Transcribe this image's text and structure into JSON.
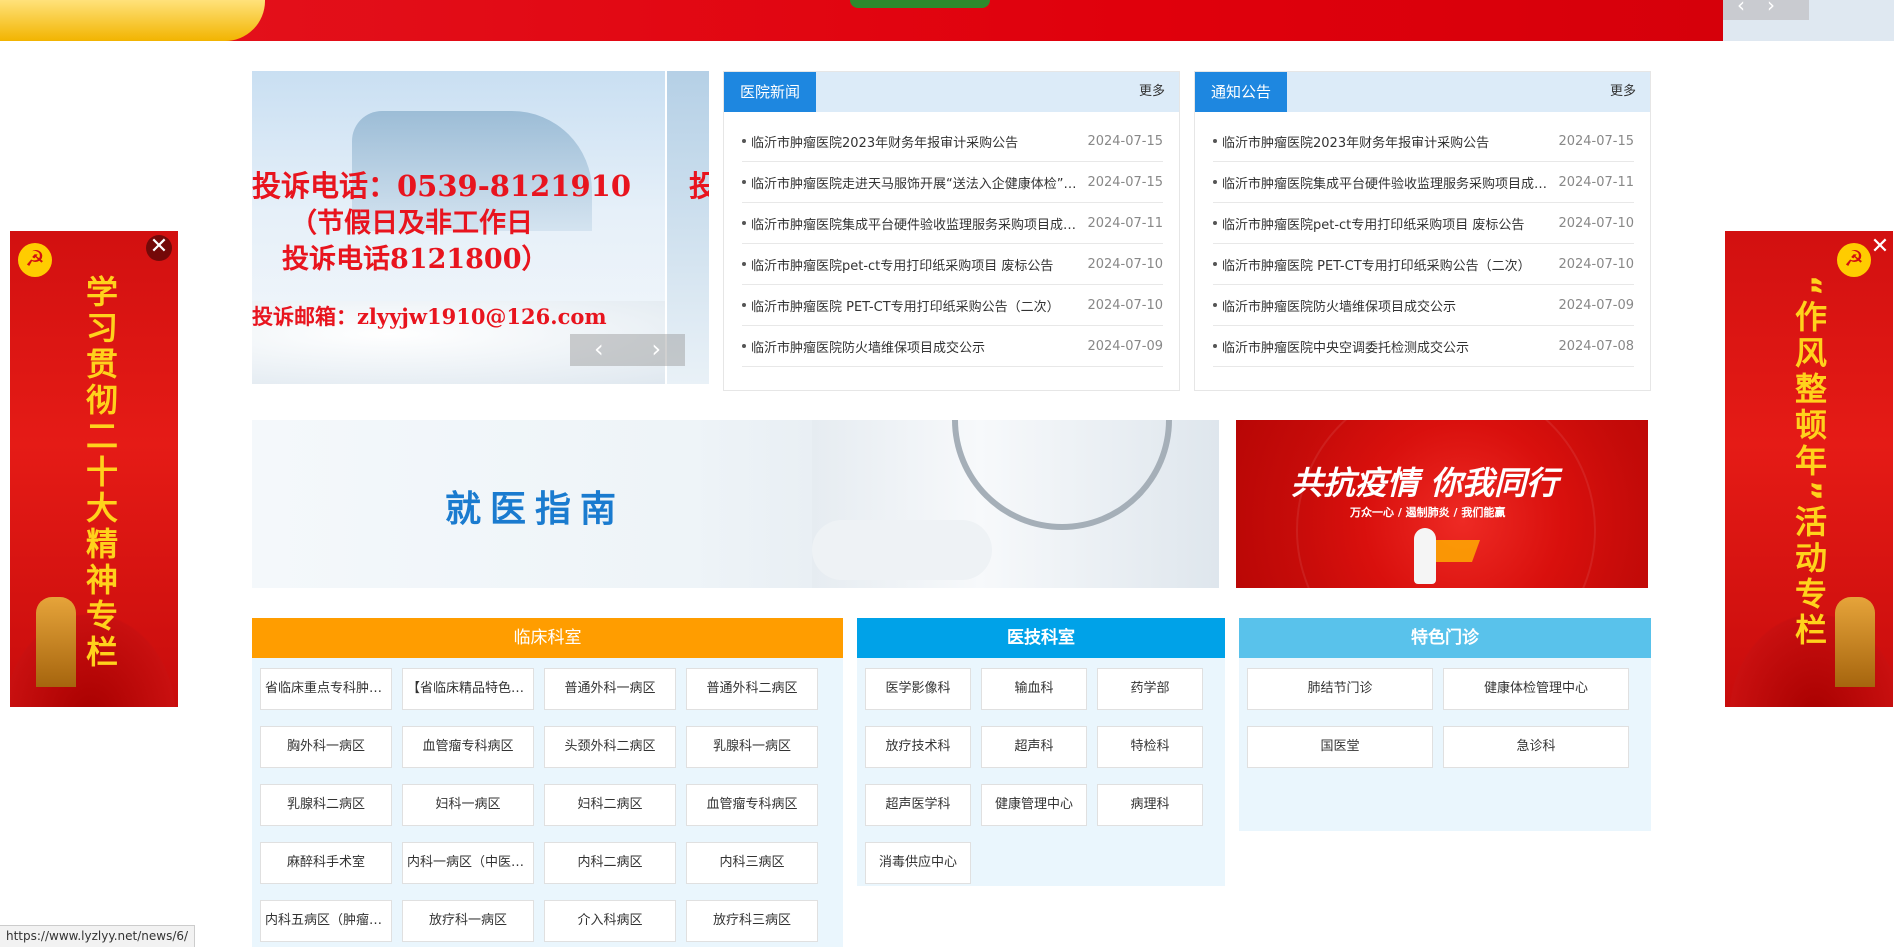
{
  "carousel": {
    "line1": "投诉电话：0539-8121910",
    "line2": "（节假日及非工作日",
    "line3": "投诉电话8121800）",
    "line4": "投诉邮箱：zlyyjw1910@126.com",
    "next_slide_char": "投",
    "prev_icon": "‹",
    "next_icon": "›"
  },
  "top_banner": {
    "prev_icon": "‹",
    "next_icon": "›"
  },
  "news": {
    "title": "医院新闻",
    "more": "更多",
    "items": [
      {
        "title": "临沂市肿瘤医院2023年财务年报审计采购公告",
        "date": "2024-07-15"
      },
      {
        "title": "临沂市肿瘤医院走进天马服饰开展“送法入企健康体检”活动",
        "date": "2024-07-15"
      },
      {
        "title": "临沂市肿瘤医院集成平台硬件验收监理服务采购项目成交公示",
        "date": "2024-07-11"
      },
      {
        "title": "临沂市肿瘤医院pet-ct专用打印纸采购项目 废标公告",
        "date": "2024-07-10"
      },
      {
        "title": "临沂市肿瘤医院 PET-CT专用打印纸采购公告（二次）",
        "date": "2024-07-10"
      },
      {
        "title": "临沂市肿瘤医院防火墙维保项目成交公示",
        "date": "2024-07-09"
      }
    ]
  },
  "notices": {
    "title": "通知公告",
    "more": "更多",
    "items": [
      {
        "title": "临沂市肿瘤医院2023年财务年报审计采购公告",
        "date": "2024-07-15"
      },
      {
        "title": "临沂市肿瘤医院集成平台硬件验收监理服务采购项目成交公示",
        "date": "2024-07-11"
      },
      {
        "title": "临沂市肿瘤医院pet-ct专用打印纸采购项目 废标公告",
        "date": "2024-07-10"
      },
      {
        "title": "临沂市肿瘤医院 PET-CT专用打印纸采购公告（二次）",
        "date": "2024-07-10"
      },
      {
        "title": "临沂市肿瘤医院防火墙维保项目成交公示",
        "date": "2024-07-09"
      },
      {
        "title": "临沂市肿瘤医院中央空调委托检测成交公示",
        "date": "2024-07-08"
      }
    ]
  },
  "guide": {
    "text": "就医指南"
  },
  "epidemic": {
    "big": "共抗疫情 你我同行",
    "small": "万众一心 / 遏制肺炎 / 我们能赢"
  },
  "clinical": {
    "title": "临床科室",
    "items": [
      "省临床重点专科肿瘤内科",
      "【省临床精品特色专科】",
      "普通外科一病区",
      "普通外科二病区",
      "胸外科一病区",
      "血管瘤专科病区",
      "头颈外科二病区",
      "乳腺科一病区",
      "乳腺科二病区",
      "妇科一病区",
      "妇科二病区",
      "血管瘤专科病区",
      "麻醉科手术室",
      "内科一病区（中医科）",
      "内科二病区",
      "内科三病区",
      "内科五病区（肿瘤科）",
      "放疗科一病区",
      "介入科病区",
      "放疗科三病区"
    ]
  },
  "medtech": {
    "title": "医技科室",
    "items": [
      "医学影像科",
      "输血科",
      "药学部",
      "放疗技术科",
      "超声科",
      "特检科",
      "超声医学科",
      "健康管理中心",
      "病理科",
      "消毒供应中心"
    ]
  },
  "special": {
    "title": "特色门诊",
    "items": [
      "肺结节门诊",
      "健康体检管理中心",
      "国医堂",
      "急诊科"
    ]
  },
  "side_left": {
    "text": "学习贯彻二十大精神专栏",
    "close": "✕",
    "emblem": "☭"
  },
  "side_right": {
    "text": "“作风整顿年”活动专栏",
    "close": "✕",
    "emblem": "☭"
  },
  "status_url": "https://www.lyzlyy.net/news/6/",
  "colors": {
    "news_tab": "#1e87e0",
    "clinical": "#ff9d00",
    "medtech": "#00a2e8",
    "special": "#59c2eb"
  }
}
